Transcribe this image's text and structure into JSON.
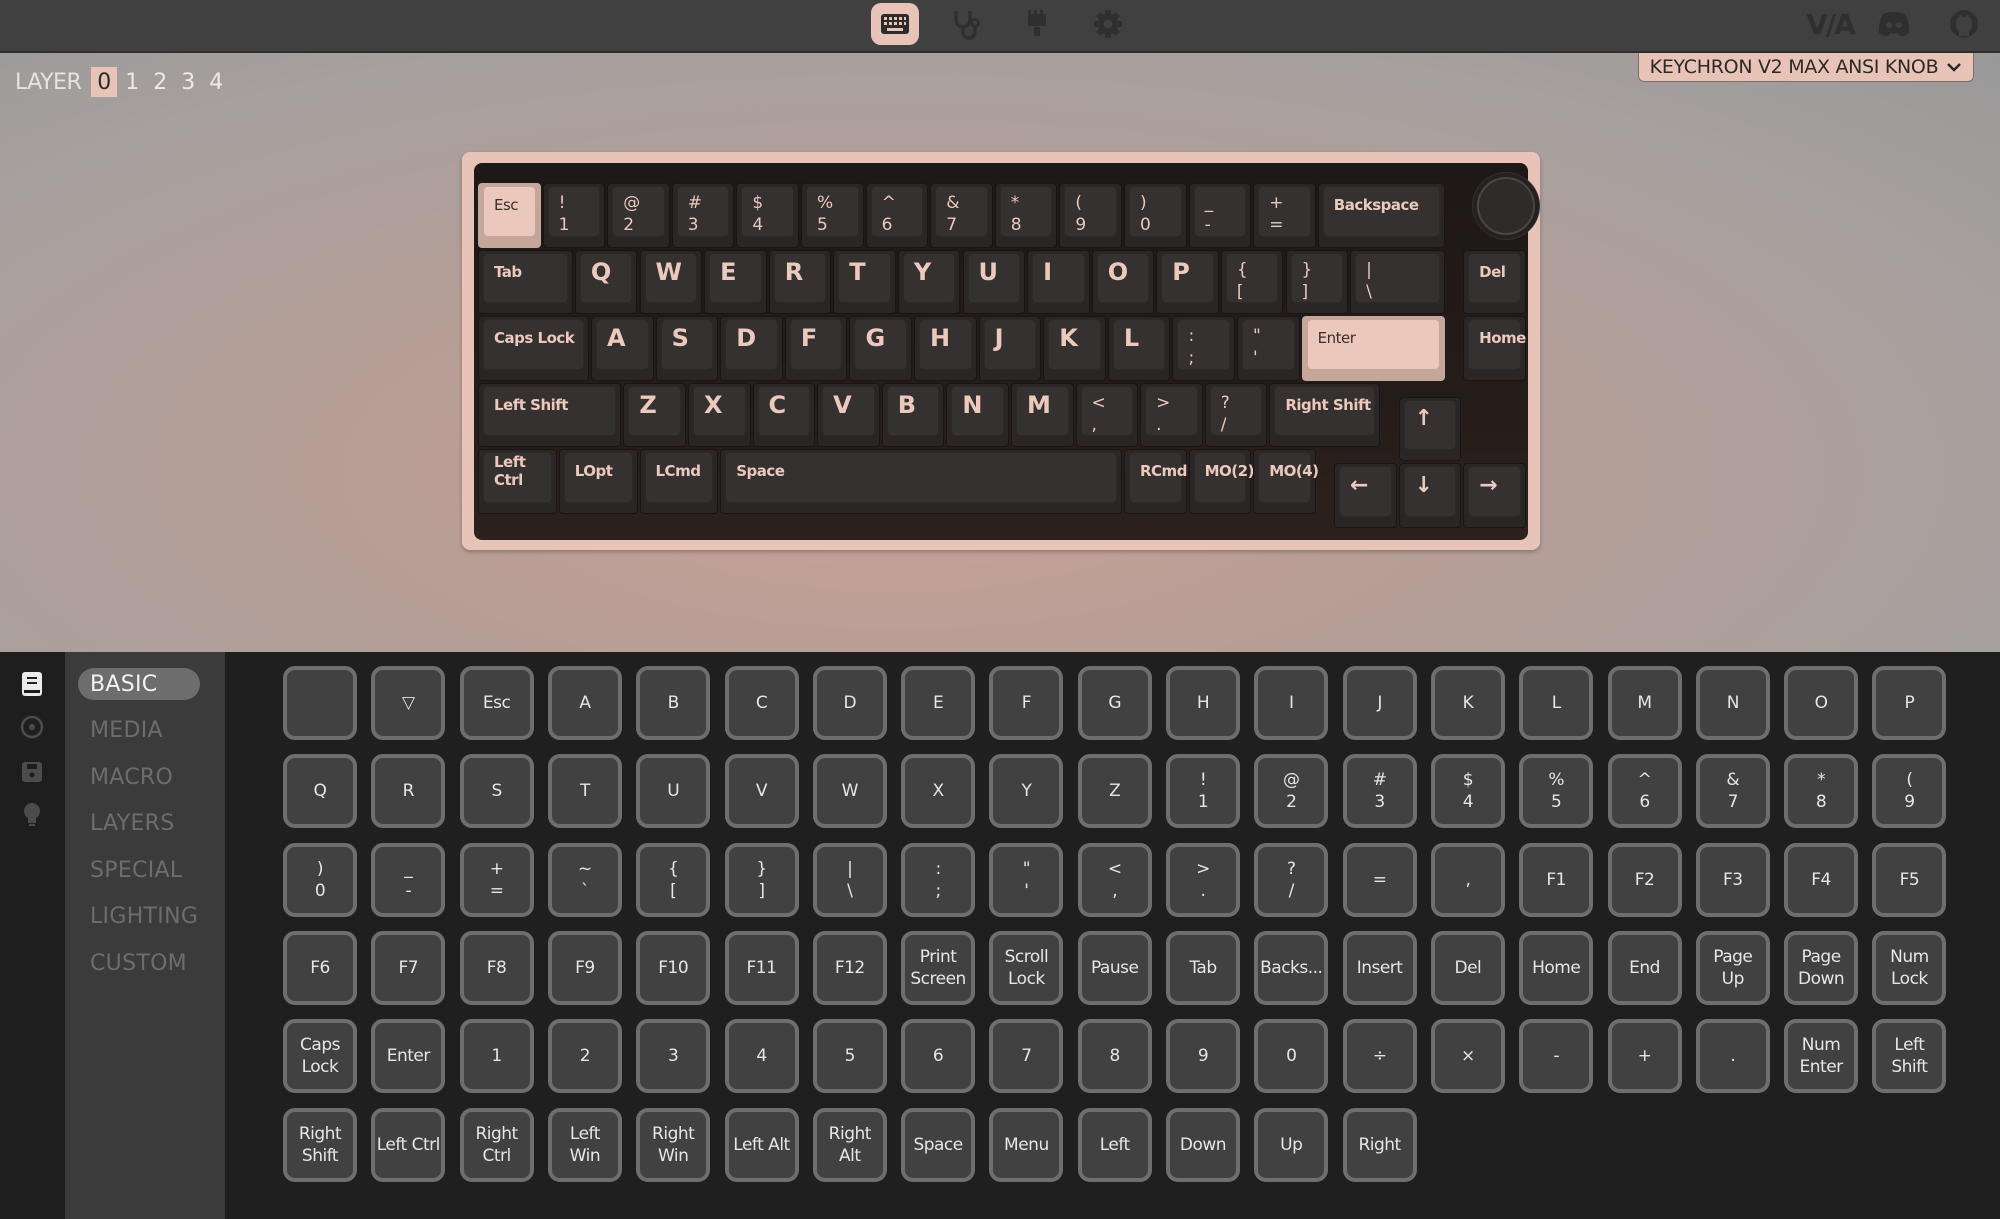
{
  "topbar": {
    "nav": [
      {
        "name": "configure-tab",
        "icon": "keyboard-icon",
        "active": true
      },
      {
        "name": "test-tab",
        "icon": "stethoscope-icon",
        "active": false
      },
      {
        "name": "design-tab",
        "icon": "paintbrush-icon",
        "active": false
      },
      {
        "name": "settings-tab",
        "icon": "gear-icon",
        "active": false
      }
    ],
    "external": [
      {
        "name": "via-logo-link",
        "icon": "via-logo",
        "text": "V/A"
      },
      {
        "name": "discord-link",
        "icon": "discord-icon"
      },
      {
        "name": "github-link",
        "icon": "github-icon"
      }
    ]
  },
  "layers": {
    "label": "LAYER",
    "items": [
      "0",
      "1",
      "2",
      "3",
      "4"
    ],
    "active": "0"
  },
  "device": {
    "name": "KEYCHRON V2 MAX ANSI KNOB",
    "chevron": "chevron-down-icon"
  },
  "keyboard": {
    "rows": [
      [
        {
          "t": "Esc",
          "w": 1,
          "x": 0,
          "k": "mod",
          "hl": true
        },
        {
          "t": "!\n1",
          "w": 1,
          "x": 1,
          "k": "dual"
        },
        {
          "t": "@\n2",
          "w": 1,
          "x": 2,
          "k": "dual"
        },
        {
          "t": "#\n3",
          "w": 1,
          "x": 3,
          "k": "dual"
        },
        {
          "t": "$\n4",
          "w": 1,
          "x": 4,
          "k": "dual"
        },
        {
          "t": "%\n5",
          "w": 1,
          "x": 5,
          "k": "dual"
        },
        {
          "t": "^\n6",
          "w": 1,
          "x": 6,
          "k": "dual"
        },
        {
          "t": "&\n7",
          "w": 1,
          "x": 7,
          "k": "dual"
        },
        {
          "t": "*\n8",
          "w": 1,
          "x": 8,
          "k": "dual"
        },
        {
          "t": "(\n9",
          "w": 1,
          "x": 9,
          "k": "dual"
        },
        {
          "t": ")\n0",
          "w": 1,
          "x": 10,
          "k": "dual"
        },
        {
          "t": "_\n-",
          "w": 1,
          "x": 11,
          "k": "dual"
        },
        {
          "t": "+\n=",
          "w": 1,
          "x": 12,
          "k": "dual"
        },
        {
          "t": "Backspace",
          "w": 2,
          "x": 13,
          "k": "mod"
        }
      ],
      [
        {
          "t": "Tab",
          "w": 1.5,
          "x": 0,
          "k": "mod"
        },
        {
          "t": "Q",
          "w": 1,
          "x": 1.5,
          "k": "alpha"
        },
        {
          "t": "W",
          "w": 1,
          "x": 2.5,
          "k": "alpha"
        },
        {
          "t": "E",
          "w": 1,
          "x": 3.5,
          "k": "alpha"
        },
        {
          "t": "R",
          "w": 1,
          "x": 4.5,
          "k": "alpha"
        },
        {
          "t": "T",
          "w": 1,
          "x": 5.5,
          "k": "alpha"
        },
        {
          "t": "Y",
          "w": 1,
          "x": 6.5,
          "k": "alpha"
        },
        {
          "t": "U",
          "w": 1,
          "x": 7.5,
          "k": "alpha"
        },
        {
          "t": "I",
          "w": 1,
          "x": 8.5,
          "k": "alpha"
        },
        {
          "t": "O",
          "w": 1,
          "x": 9.5,
          "k": "alpha"
        },
        {
          "t": "P",
          "w": 1,
          "x": 10.5,
          "k": "alpha"
        },
        {
          "t": "{\n[",
          "w": 1,
          "x": 11.5,
          "k": "dual"
        },
        {
          "t": "}\n]",
          "w": 1,
          "x": 12.5,
          "k": "dual"
        },
        {
          "t": "|\n\\",
          "w": 1.5,
          "x": 13.5,
          "k": "dual"
        },
        {
          "t": "Del",
          "w": 1,
          "x": 15.25,
          "k": "mod"
        }
      ],
      [
        {
          "t": "Caps Lock",
          "w": 1.75,
          "x": 0,
          "k": "mod"
        },
        {
          "t": "A",
          "w": 1,
          "x": 1.75,
          "k": "alpha"
        },
        {
          "t": "S",
          "w": 1,
          "x": 2.75,
          "k": "alpha"
        },
        {
          "t": "D",
          "w": 1,
          "x": 3.75,
          "k": "alpha"
        },
        {
          "t": "F",
          "w": 1,
          "x": 4.75,
          "k": "alpha"
        },
        {
          "t": "G",
          "w": 1,
          "x": 5.75,
          "k": "alpha"
        },
        {
          "t": "H",
          "w": 1,
          "x": 6.75,
          "k": "alpha"
        },
        {
          "t": "J",
          "w": 1,
          "x": 7.75,
          "k": "alpha"
        },
        {
          "t": "K",
          "w": 1,
          "x": 8.75,
          "k": "alpha"
        },
        {
          "t": "L",
          "w": 1,
          "x": 9.75,
          "k": "alpha"
        },
        {
          "t": ":\n;",
          "w": 1,
          "x": 10.75,
          "k": "dual"
        },
        {
          "t": "\"\n'",
          "w": 1,
          "x": 11.75,
          "k": "dual"
        },
        {
          "t": "Enter",
          "w": 2.25,
          "x": 12.75,
          "k": "mod",
          "hl": true
        },
        {
          "t": "Home",
          "w": 1,
          "x": 15.25,
          "k": "mod"
        }
      ],
      [
        {
          "t": "Left Shift",
          "w": 2.25,
          "x": 0,
          "k": "mod"
        },
        {
          "t": "Z",
          "w": 1,
          "x": 2.25,
          "k": "alpha"
        },
        {
          "t": "X",
          "w": 1,
          "x": 3.25,
          "k": "alpha"
        },
        {
          "t": "C",
          "w": 1,
          "x": 4.25,
          "k": "alpha"
        },
        {
          "t": "V",
          "w": 1,
          "x": 5.25,
          "k": "alpha"
        },
        {
          "t": "B",
          "w": 1,
          "x": 6.25,
          "k": "alpha"
        },
        {
          "t": "N",
          "w": 1,
          "x": 7.25,
          "k": "alpha"
        },
        {
          "t": "M",
          "w": 1,
          "x": 8.25,
          "k": "alpha"
        },
        {
          "t": "<\n,",
          "w": 1,
          "x": 9.25,
          "k": "dual"
        },
        {
          "t": ">\n.",
          "w": 1,
          "x": 10.25,
          "k": "dual"
        },
        {
          "t": "?\n/",
          "w": 1,
          "x": 11.25,
          "k": "dual"
        },
        {
          "t": "Right Shift",
          "w": 1.75,
          "x": 12.25,
          "k": "mod"
        },
        {
          "t": "↑",
          "w": 1,
          "x": 14.25,
          "k": "arrow",
          "dy": 0.25
        }
      ],
      [
        {
          "t": "Left Ctrl",
          "w": 1.25,
          "x": 0,
          "k": "mod"
        },
        {
          "t": "LOpt",
          "w": 1.25,
          "x": 1.25,
          "k": "mod"
        },
        {
          "t": "LCmd",
          "w": 1.25,
          "x": 2.5,
          "k": "mod"
        },
        {
          "t": "Space",
          "w": 6.25,
          "x": 3.75,
          "k": "mod"
        },
        {
          "t": "RCmd",
          "w": 1,
          "x": 10,
          "k": "mod"
        },
        {
          "t": "MO(2)",
          "w": 1,
          "x": 11,
          "k": "mod"
        },
        {
          "t": "MO(4)",
          "w": 1,
          "x": 12,
          "k": "mod"
        },
        {
          "t": "←",
          "w": 1,
          "x": 13.25,
          "k": "arrow",
          "dy": 0.25
        },
        {
          "t": "↓",
          "w": 1,
          "x": 14.25,
          "k": "arrow",
          "dy": 0.25
        },
        {
          "t": "→",
          "w": 1,
          "x": 15.25,
          "k": "arrow",
          "dy": 0.25
        }
      ]
    ],
    "knob": "rotary-knob"
  },
  "sidebar": {
    "rail": [
      {
        "name": "keymap-rail-icon",
        "icon": "book-icon",
        "active": true
      },
      {
        "name": "media-rail-icon",
        "icon": "disc-icon",
        "active": false
      },
      {
        "name": "save-rail-icon",
        "icon": "floppy-disk-icon",
        "active": false
      },
      {
        "name": "lighting-rail-icon",
        "icon": "lightbulb-icon",
        "active": false
      }
    ],
    "categories": [
      {
        "label": "BASIC",
        "active": true
      },
      {
        "label": "MEDIA",
        "active": false
      },
      {
        "label": "MACRO",
        "active": false
      },
      {
        "label": "LAYERS",
        "active": false
      },
      {
        "label": "SPECIAL",
        "active": false
      },
      {
        "label": "LIGHTING",
        "active": false
      },
      {
        "label": "CUSTOM",
        "active": false
      }
    ]
  },
  "keycodes": [
    "",
    "▽",
    "Esc",
    "A",
    "B",
    "C",
    "D",
    "E",
    "F",
    "G",
    "H",
    "I",
    "J",
    "K",
    "L",
    "M",
    "N",
    "O",
    "P",
    "Q",
    "R",
    "S",
    "T",
    "U",
    "V",
    "W",
    "X",
    "Y",
    "Z",
    "!\n1",
    "@\n2",
    "#\n3",
    "$\n4",
    "%\n5",
    "^\n6",
    "&\n7",
    "*\n8",
    "(\n9",
    ")\n0",
    "_\n-",
    "+\n=",
    "~\n`",
    "{\n[",
    "}\n]",
    "|\n\\",
    ":\n;",
    "\"\n'",
    "<\n,",
    ">\n.",
    "?\n/",
    "=",
    ",",
    "F1",
    "F2",
    "F3",
    "F4",
    "F5",
    "F6",
    "F7",
    "F8",
    "F9",
    "F10",
    "F11",
    "F12",
    "Print\nScreen",
    "Scroll\nLock",
    "Pause",
    "Tab",
    "Backs...",
    "Insert",
    "Del",
    "Home",
    "End",
    "Page\nUp",
    "Page\nDown",
    "Num\nLock",
    "Caps\nLock",
    "Enter",
    "1",
    "2",
    "3",
    "4",
    "5",
    "6",
    "7",
    "8",
    "9",
    "0",
    "÷",
    "×",
    "-",
    "+",
    ".",
    "Num\nEnter",
    "Left\nShift",
    "Right\nShift",
    "Left Ctrl",
    "Right\nCtrl",
    "Left\nWin",
    "Right\nWin",
    "Left Alt",
    "Right\nAlt",
    "Space",
    "Menu",
    "Left",
    "Down",
    "Up",
    "Right"
  ],
  "colors": {
    "accent": "#e8c4b8",
    "topbar": "#404040",
    "panel": "#1f1f1f",
    "menu": "#3b3b3b",
    "keycap_legend": "#ecc9bd"
  }
}
